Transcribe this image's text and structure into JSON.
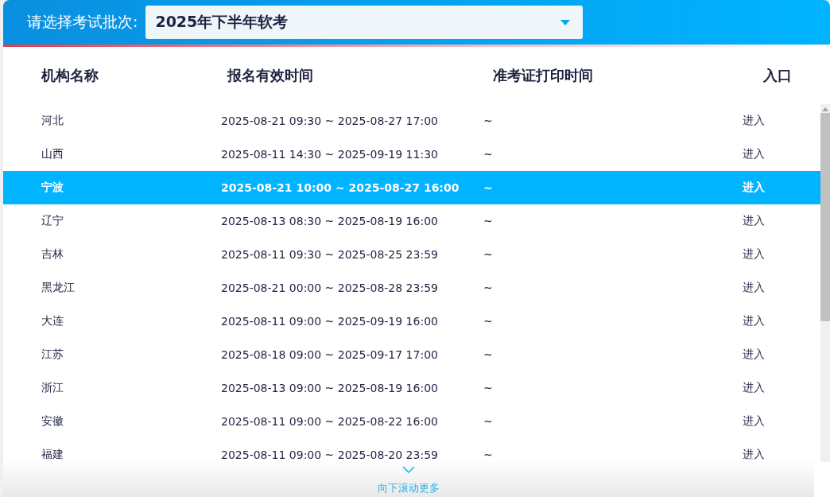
{
  "batch_select": {
    "label": "请选择考试批次:",
    "value": "2025年下半年软考"
  },
  "table": {
    "columns": [
      "机构名称",
      "报名有效时间",
      "准考证打印时间",
      "入口"
    ],
    "rows": [
      {
        "name": "河北",
        "registration": "2025-08-21 09:30 ~ 2025-08-27 17:00",
        "print_time": "~",
        "entry": "进入",
        "selected": false
      },
      {
        "name": "山西",
        "registration": "2025-08-11 14:30 ~ 2025-09-19 11:30",
        "print_time": "~",
        "entry": "进入",
        "selected": false
      },
      {
        "name": "宁波",
        "registration": "2025-08-21 10:00 ~ 2025-08-27 16:00",
        "print_time": "~",
        "entry": "进入",
        "selected": true
      },
      {
        "name": "辽宁",
        "registration": "2025-08-13 08:30 ~ 2025-08-19 16:00",
        "print_time": "~",
        "entry": "进入",
        "selected": false
      },
      {
        "name": "吉林",
        "registration": "2025-08-11 09:30 ~ 2025-08-25 23:59",
        "print_time": "~",
        "entry": "进入",
        "selected": false
      },
      {
        "name": "黑龙江",
        "registration": "2025-08-21 00:00 ~ 2025-08-28 23:59",
        "print_time": "~",
        "entry": "进入",
        "selected": false
      },
      {
        "name": "大连",
        "registration": "2025-08-11 09:00 ~ 2025-09-19 16:00",
        "print_time": "~",
        "entry": "进入",
        "selected": false
      },
      {
        "name": "江苏",
        "registration": "2025-08-18 09:00 ~ 2025-09-17 17:00",
        "print_time": "~",
        "entry": "进入",
        "selected": false
      },
      {
        "name": "浙江",
        "registration": "2025-08-13 09:00 ~ 2025-08-19 16:00",
        "print_time": "~",
        "entry": "进入",
        "selected": false
      },
      {
        "name": "安徽",
        "registration": "2025-08-11 09:00 ~ 2025-08-22 16:00",
        "print_time": "~",
        "entry": "进入",
        "selected": false
      },
      {
        "name": "福建",
        "registration": "2025-08-11 09:00 ~ 2025-08-20 23:59",
        "print_time": "~",
        "entry": "进入",
        "selected": false
      }
    ]
  },
  "scroll_hint": "向下滚动更多"
}
